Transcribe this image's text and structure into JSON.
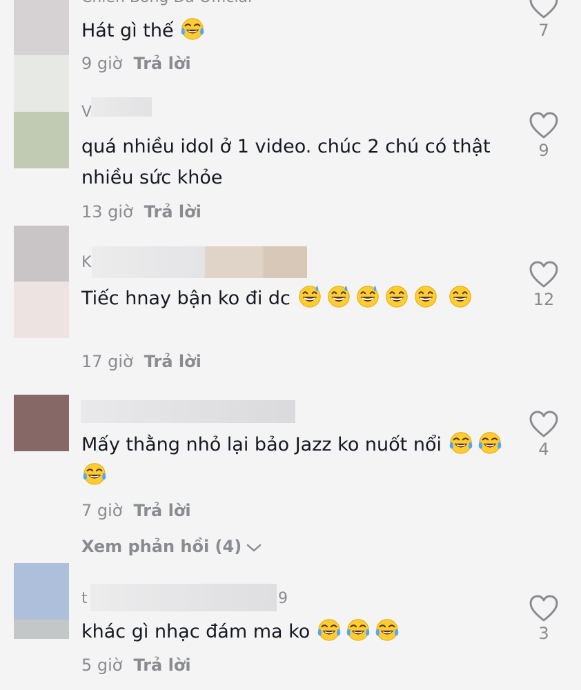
{
  "comments": [
    {
      "username": "Chien Bong Da Official",
      "text": "Hát gì thế",
      "emojis": [
        "laugh-tears"
      ],
      "time": "9 giờ",
      "reply": "Trả lời",
      "likes": "7"
    },
    {
      "username": "V",
      "text": "quá nhiều idol ở 1 video. chúc 2 chú có thật nhiều sức khỏe",
      "emojis": [],
      "time": "13 giờ",
      "reply": "Trả lời",
      "likes": "9"
    },
    {
      "username": "K",
      "text": "Tiếc hnay bận ko đi dc",
      "emojis": [
        "grin-sweat",
        "grin-sweat",
        "grin-sweat",
        "grin",
        "grin",
        "grin"
      ],
      "time": "17 giờ",
      "reply": "Trả lời",
      "likes": "12"
    },
    {
      "username": "",
      "text": "Mấy thằng nhỏ lại bảo Jazz ko nuốt nổi",
      "emojis": [
        "laugh-tears",
        "laugh-tears",
        "laugh-tears"
      ],
      "time": "7 giờ",
      "reply": "Trả lời",
      "likes": "4",
      "view_replies": "Xem phản hồi (4)"
    },
    {
      "username_start": "t",
      "username_end": "9",
      "text": "khác gì nhạc đám ma ko",
      "emojis": [
        "laugh-tears",
        "laugh-tears",
        "laugh-tears"
      ],
      "time": "5 giờ",
      "reply": "Trả lời",
      "likes": "3"
    }
  ],
  "icons": {
    "like": "heart-outline-icon",
    "expand": "chevron-down-icon"
  },
  "colors": {
    "background": "#f4f4f5",
    "text": "#161823",
    "muted": "#8a8b91"
  }
}
